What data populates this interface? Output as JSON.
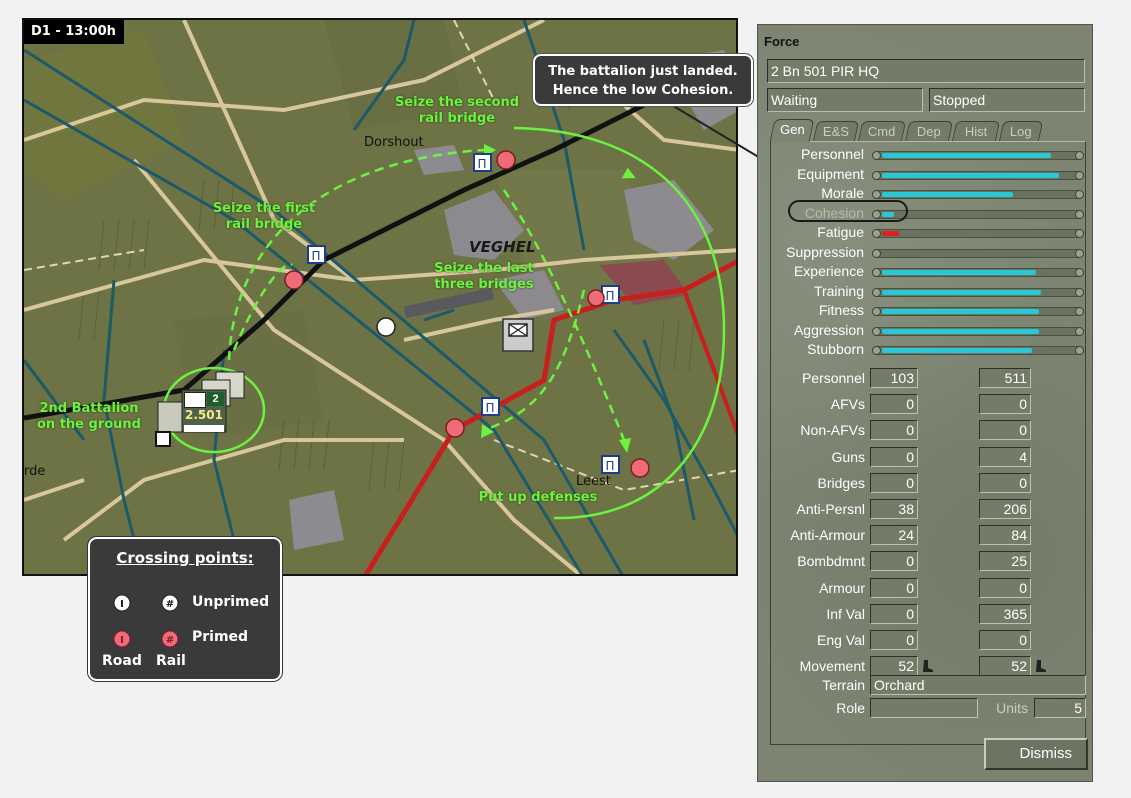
{
  "map": {
    "time_label": "D1 - 13:00h",
    "places": {
      "dorshout": "Dorshout",
      "veghel": "VEGHEL",
      "leest": "Leest",
      "rde": "rde"
    },
    "annotations": {
      "second_bridge": "Seize the second\nrail bridge",
      "first_bridge": "Seize the first\nrail bridge",
      "last_bridges": "Seize the last\nthree bridges",
      "battalion": "2nd Battalion\non the ground",
      "defenses": "Put up defenses"
    },
    "callout": "The battalion just landed.\nHence the low Cohesion.",
    "unit_label": "2.501",
    "unit_step": "2",
    "legend": {
      "title": "Crossing points:",
      "unprimed": "Unprimed",
      "primed": "Primed",
      "road": "Road",
      "rail": "Rail"
    },
    "colors": {
      "cohesion_ring": "#1a1a1a",
      "annotation": "#6cf241",
      "road_red": "#c81e1e",
      "primed": "#ef6b78"
    }
  },
  "panel": {
    "title": "Force",
    "unit_name": "2 Bn 501 PIR HQ",
    "status_left": "Waiting",
    "status_right": "Stopped",
    "tabs": [
      {
        "label": "Gen",
        "active": true
      },
      {
        "label": "E&S",
        "active": false
      },
      {
        "label": "Cmd",
        "active": false
      },
      {
        "label": "Dep",
        "active": false
      },
      {
        "label": "Hist",
        "active": false
      },
      {
        "label": "Log",
        "active": false
      }
    ],
    "bars": [
      {
        "label": "Personnel",
        "value": 0.88,
        "color": "#29c8d6",
        "dim": false
      },
      {
        "label": "Equipment",
        "value": 0.92,
        "color": "#29c8d6",
        "dim": false
      },
      {
        "label": "Morale",
        "value": 0.68,
        "color": "#29c8d6",
        "dim": false
      },
      {
        "label": "Cohesion",
        "value": 0.06,
        "color": "#29c8d6",
        "dim": true
      },
      {
        "label": "Fatigue",
        "value": 0.09,
        "color": "#e02020",
        "dim": false
      },
      {
        "label": "Suppression",
        "value": 0.0,
        "color": "#29c8d6",
        "dim": false
      },
      {
        "label": "Experience",
        "value": 0.8,
        "color": "#29c8d6",
        "dim": false
      },
      {
        "label": "Training",
        "value": 0.83,
        "color": "#29c8d6",
        "dim": false
      },
      {
        "label": "Fitness",
        "value": 0.82,
        "color": "#29c8d6",
        "dim": false
      },
      {
        "label": "Aggression",
        "value": 0.82,
        "color": "#29c8d6",
        "dim": false
      },
      {
        "label": "Stubborn",
        "value": 0.78,
        "color": "#29c8d6",
        "dim": false
      }
    ],
    "stats": [
      {
        "label": "Personnel",
        "a": "103",
        "b": "511"
      },
      {
        "label": "AFVs",
        "a": "0",
        "b": "0"
      },
      {
        "label": "Non-AFVs",
        "a": "0",
        "b": "0"
      },
      {
        "label": "Guns",
        "a": "0",
        "b": "4"
      },
      {
        "label": "Bridges",
        "a": "0",
        "b": "0"
      },
      {
        "label": "Anti-Persnl",
        "a": "38",
        "b": "206"
      },
      {
        "label": "Anti-Armour",
        "a": "24",
        "b": "84"
      },
      {
        "label": "Bombdmnt",
        "a": "0",
        "b": "25"
      },
      {
        "label": "Armour",
        "a": "0",
        "b": "0"
      },
      {
        "label": "Inf Val",
        "a": "0",
        "b": "365"
      },
      {
        "label": "Eng Val",
        "a": "0",
        "b": "0"
      },
      {
        "label": "Movement",
        "a": "52",
        "b": "52"
      }
    ],
    "terrain_label": "Terrain",
    "terrain_value": "Orchard",
    "role_label": "Role",
    "role_value": "",
    "units_label": "Units",
    "units_value": "5",
    "dismiss_label": "Dismiss"
  }
}
